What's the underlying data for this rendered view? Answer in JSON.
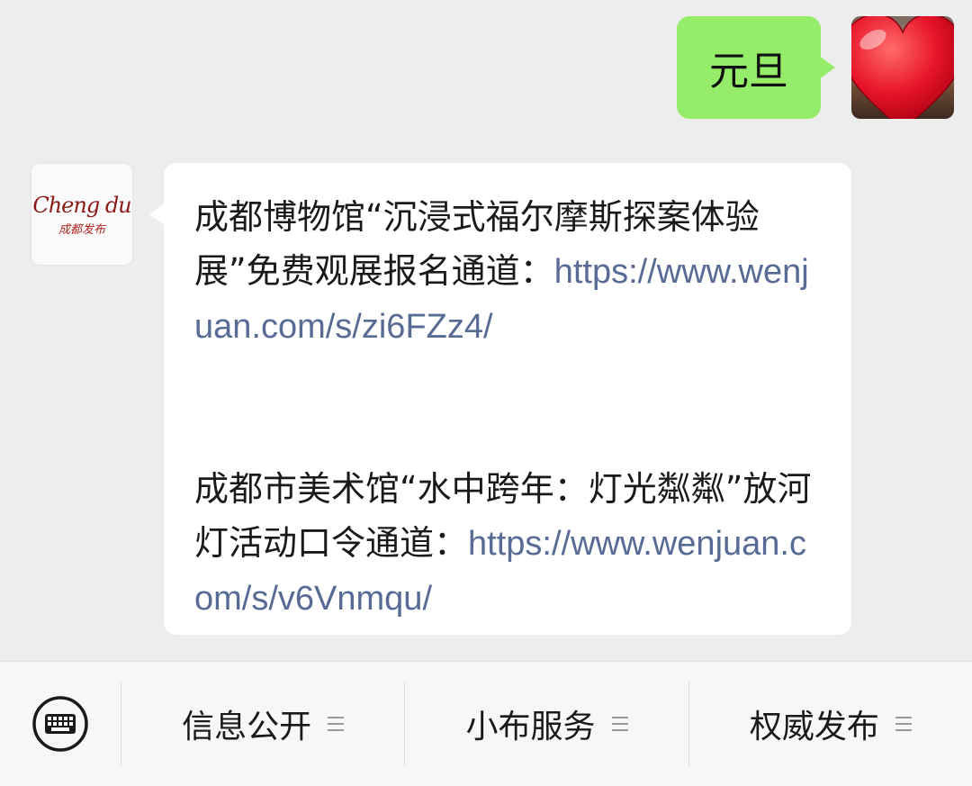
{
  "chat": {
    "outgoing_message": "元旦",
    "incoming": {
      "avatar_logo_text": "Cheng du",
      "avatar_logo_subtext": "成都发布",
      "paragraph1_text": "成都博物馆“沉浸式福尔摩斯探案体验展”免费观展报名通道：",
      "paragraph1_link": "https://www.wenjuan.com/s/zi6FZz4/",
      "paragraph2_text": "成都市美术馆“水中跨年：灯光粼粼”放河灯活动口令通道：",
      "paragraph2_link": "https://www.wenjuan.com/s/v6Vnmqu/"
    }
  },
  "menu": {
    "keyboard_icon": "keyboard-icon",
    "items": [
      {
        "label": "信息公开"
      },
      {
        "label": "小布服务"
      },
      {
        "label": "权威发布"
      }
    ]
  },
  "colors": {
    "background": "#ededed",
    "outgoing_bubble": "#95ec69",
    "incoming_bubble": "#ffffff",
    "link": "#576b95",
    "heart": "#e8142a"
  }
}
